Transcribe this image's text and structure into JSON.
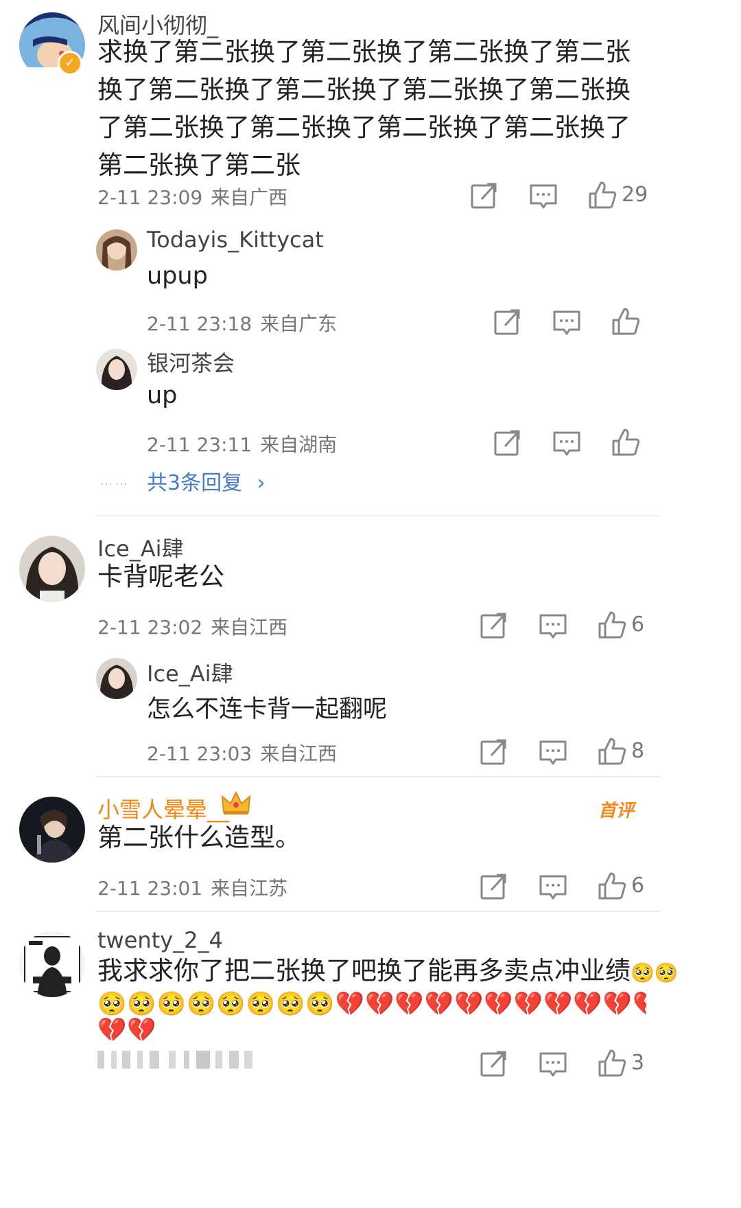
{
  "comments": [
    {
      "username": "风间小彻彻_",
      "text": "求换了第二张换了第二张换了第二张换了第二张换了第二张换了第二张换了第二张换了第二张换了第二张换了第二张换了第二张换了第二张换了第二张换了第二张",
      "date": "2-11 23:09",
      "location": "来自广西",
      "likes": "29",
      "verified": true,
      "replies": [
        {
          "username": "Todayis_Kittycat",
          "text": "upup",
          "date": "2-11 23:18",
          "location": "来自广东"
        },
        {
          "username": "银河茶会",
          "text": "up",
          "date": "2-11 23:11",
          "location": "来自湖南"
        }
      ],
      "more_replies": "共3条回复",
      "more_dots": "……"
    },
    {
      "username": "Ice_Ai肆",
      "text": "卡背呢老公",
      "date": "2-11 23:02",
      "location": "来自江西",
      "likes": "6",
      "replies": [
        {
          "username": "Ice_Ai肆",
          "text": "怎么不连卡背一起翻呢",
          "date": "2-11 23:03",
          "location": "来自江西",
          "likes": "8"
        }
      ]
    },
    {
      "username": "小雪人晕晕__",
      "text": "第二张什么造型。",
      "date": "2-11 23:01",
      "location": "来自江苏",
      "likes": "6",
      "badge": "首评",
      "crown_icon": "crown-icon"
    },
    {
      "username": "twenty_2_4",
      "text": "我求求你了把二张换了吧换了能再多卖点冲业绩",
      "emoji_line1_tail": "🥺🥺",
      "emoji_line2": "🥺🥺🥺🥺🥺🥺🥺🥺💔💔💔💔💔💔💔💔💔💔💔💔💔💔💔",
      "emoji_line3": "💔💔",
      "likes": "3"
    }
  ],
  "colors": {
    "link": "#4a7bbf",
    "gold_name": "#e88a1a",
    "meta": "#777777",
    "divider": "#ececec"
  },
  "icons": [
    "share-icon",
    "comment-icon",
    "like-icon",
    "chevron-right-icon",
    "verified-icon"
  ]
}
